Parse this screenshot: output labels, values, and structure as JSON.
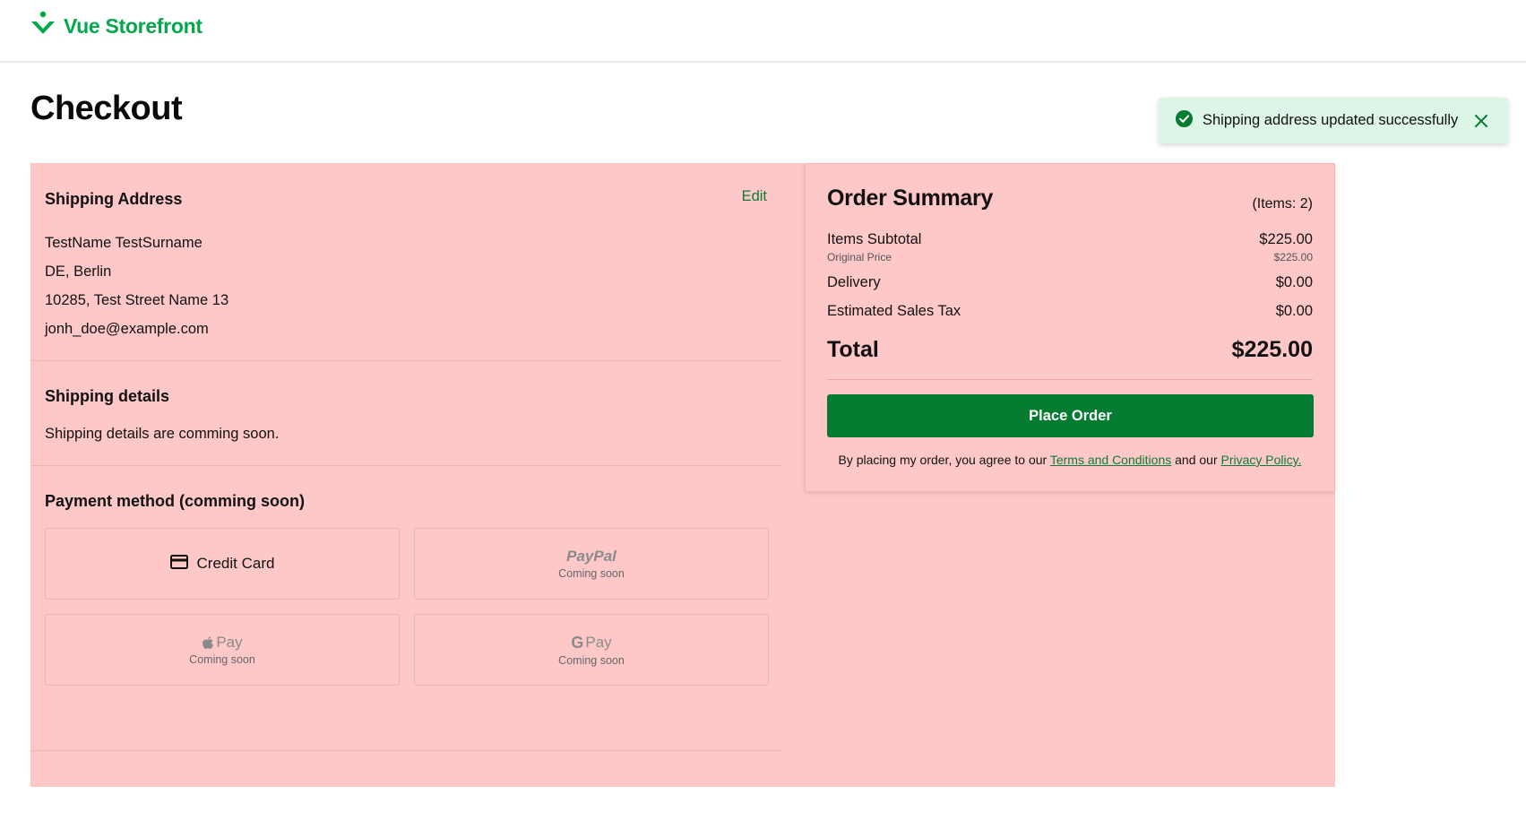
{
  "header": {
    "brand": "Vue Storefront",
    "brand_color": "#02a84a",
    "logo_icon": "vue-storefront-logo-icon"
  },
  "page": {
    "title": "Checkout"
  },
  "toast": {
    "message": "Shipping address updated successfully",
    "icon": "check-circle-icon",
    "close_icon": "close-icon",
    "background": "#dcf5e7"
  },
  "shipping_address": {
    "title": "Shipping Address",
    "edit_label": "Edit",
    "lines": [
      "TestName TestSurname",
      "DE, Berlin",
      "10285, Test Street Name 13",
      "jonh_doe@example.com"
    ]
  },
  "shipping_details": {
    "title": "Shipping details",
    "text": "Shipping details are comming soon."
  },
  "payment": {
    "title": "Payment method (comming soon)",
    "options": [
      {
        "label": "Credit Card",
        "icon": "credit-card-icon",
        "status": ""
      },
      {
        "label": "PayPal",
        "icon": "paypal-logo",
        "status": "Coming soon"
      },
      {
        "label": "Pay",
        "icon": "apple-pay-logo",
        "status": "Coming soon"
      },
      {
        "label": "Pay",
        "icon": "google-pay-logo",
        "status": "Coming soon"
      }
    ]
  },
  "summary": {
    "title": "Order Summary",
    "items_count": "(Items: 2)",
    "subtotal_label": "Items Subtotal",
    "subtotal_value": "$225.00",
    "original_label": "Original Price",
    "original_value": "$225.00",
    "delivery_label": "Delivery",
    "delivery_value": "$0.00",
    "tax_label": "Estimated Sales Tax",
    "tax_value": "$0.00",
    "total_label": "Total",
    "total_value": "$225.00",
    "place_order": "Place Order",
    "button_color": "#067c32",
    "legal_prefix": "By placing my order, you agree to our",
    "terms_link": "Terms and Conditions",
    "legal_middle": "and our",
    "privacy_link": "Privacy Policy."
  },
  "highlight_color": "#ffc8c8"
}
